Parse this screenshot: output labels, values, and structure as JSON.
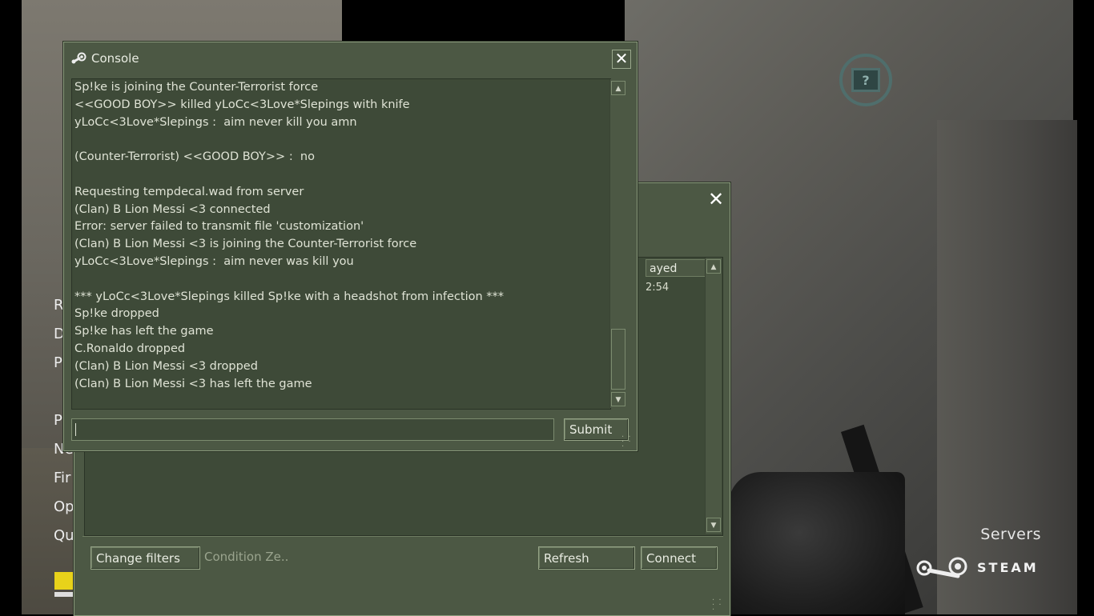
{
  "background": {
    "menu_fragments": [
      "R",
      "D",
      "P",
      "P",
      "Ne",
      "Fir",
      "Op",
      "Qu"
    ],
    "servers_label": "Servers",
    "steam_label": "STEAM"
  },
  "server_browser": {
    "close_glyph": "✕",
    "column_header": "ayed",
    "row_value": "2:54",
    "buttons": {
      "change_filters": "Change filters",
      "refresh": "Refresh",
      "connect": "Connect"
    },
    "filter_text": "Condition Ze.."
  },
  "console": {
    "title": "Console",
    "close_glyph": "✕",
    "submit_label": "Submit",
    "input_value": "",
    "lines": [
      "Sp!ke is joining the Counter-Terrorist force",
      "<<GOOD BOY>> killed yLoCc<3Love*Slepings with knife",
      "yLoCc<3Love*Slepings :  aim never kill you amn",
      "",
      "(Counter-Terrorist) <<GOOD BOY>> :  no",
      "",
      "Requesting tempdecal.wad from server",
      "(Clan) B Lion Messi <3 connected",
      "Error: server failed to transmit file 'customization'",
      "(Clan) B Lion Messi <3 is joining the Counter-Terrorist force",
      "yLoCc<3Love*Slepings :  aim never was kill you",
      "",
      "*** yLoCc<3Love*Slepings killed Sp!ke with a headshot from infection ***",
      "Sp!ke dropped",
      "Sp!ke has left the game",
      "C.Ronaldo dropped",
      "(Clan) B Lion Messi <3 dropped",
      "(Clan) B Lion Messi <3 has left the game"
    ]
  },
  "colors": {
    "panel": "#4c5844",
    "panel_dark": "#3e4a38",
    "border_light": "#8a9a7c",
    "text": "#dfe3d5"
  }
}
